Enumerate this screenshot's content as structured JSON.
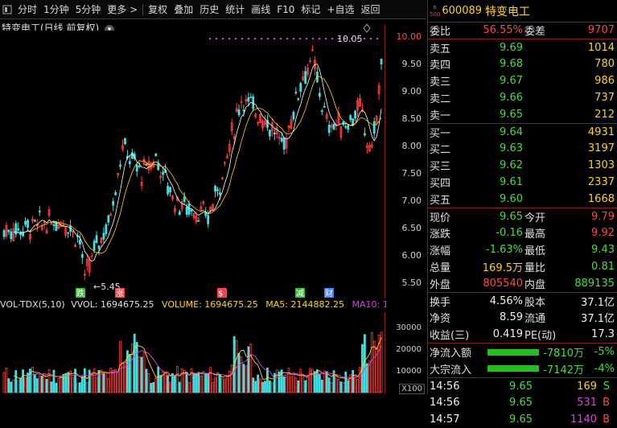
{
  "toolbar": {
    "items": [
      "分时",
      "1分钟",
      "5分钟",
      "更多 >",
      "复权",
      "叠加",
      "历史",
      "统计",
      "画线",
      "F10",
      "标记",
      "+自选",
      "返回"
    ]
  },
  "chart": {
    "title": "特变电工(日线 前复权)",
    "price_high_label": "10.05",
    "price_low_label": "5.45",
    "y_ticks": [
      "10.00",
      "9.50",
      "9.00",
      "8.50",
      "8.00",
      "7.50",
      "7.00",
      "6.50",
      "6.00",
      "5.50"
    ],
    "markers": [
      {
        "text": "跌",
        "color": "#30c030"
      },
      {
        "text": "涨",
        "color": "#ff4040"
      },
      {
        "text": "$",
        "color": "#ff4040"
      },
      {
        "text": "减",
        "color": "#30c030"
      },
      {
        "text": "财",
        "color": "#4080ff"
      }
    ]
  },
  "volume": {
    "name": "VOL-TDX(5,10)",
    "vvol": "VVOL: 1694675.25",
    "volume": "VOLUME: 1694675.25",
    "ma5": "MA5: 2144882.25",
    "ma10": "MA10: 1",
    "y_ticks": [
      "30000",
      "20000",
      "10000"
    ],
    "unit": "X100"
  },
  "quote": {
    "badge_top": "R",
    "badge_bot": "500",
    "code": "600089",
    "name": "特变电工",
    "weibi_label": "委比",
    "weibi": "56.55%",
    "weicha_label": "委差",
    "weicha": "9707",
    "asks": [
      {
        "label": "卖五",
        "price": "9.69",
        "vol": "1014"
      },
      {
        "label": "卖四",
        "price": "9.68",
        "vol": "780"
      },
      {
        "label": "卖三",
        "price": "9.67",
        "vol": "986"
      },
      {
        "label": "卖二",
        "price": "9.66",
        "vol": "737"
      },
      {
        "label": "卖一",
        "price": "9.65",
        "vol": "212"
      }
    ],
    "bids": [
      {
        "label": "买一",
        "price": "9.64",
        "vol": "4931"
      },
      {
        "label": "买二",
        "price": "9.63",
        "vol": "3197"
      },
      {
        "label": "买三",
        "price": "9.62",
        "vol": "1303"
      },
      {
        "label": "买四",
        "price": "9.61",
        "vol": "2337"
      },
      {
        "label": "买五",
        "price": "9.60",
        "vol": "1668"
      }
    ],
    "stats": [
      {
        "l1": "现价",
        "v1": "9.65",
        "c1": "g",
        "l2": "今开",
        "v2": "9.79",
        "c2": "r"
      },
      {
        "l1": "涨跌",
        "v1": "-0.16",
        "c1": "g",
        "l2": "最高",
        "v2": "9.92",
        "c2": "r"
      },
      {
        "l1": "涨幅",
        "v1": "-1.63%",
        "c1": "g",
        "l2": "最低",
        "v2": "9.43",
        "c2": "g"
      },
      {
        "l1": "总量",
        "v1": "169.5万",
        "c1": "y",
        "l2": "量比",
        "v2": "0.81",
        "c2": "g"
      },
      {
        "l1": "外盘",
        "v1": "805540",
        "c1": "r",
        "l2": "内盘",
        "v2": "889135",
        "c2": "g"
      }
    ],
    "stats2": [
      {
        "l1": "换手",
        "v1": "4.56%",
        "c1": "w",
        "l2": "股本",
        "v2": "37.1亿",
        "c2": "w"
      },
      {
        "l1": "净资",
        "v1": "8.59",
        "c1": "w",
        "l2": "流通",
        "v2": "37.1亿",
        "c2": "w"
      },
      {
        "l1": "收益(三)",
        "v1": "0.419",
        "c1": "w",
        "l2": "PE(动)",
        "v2": "17.3",
        "c2": "w"
      }
    ],
    "flows": [
      {
        "label": "净流入额",
        "value": "-7810万",
        "pct": "-5%"
      },
      {
        "label": "大宗流入",
        "value": "-7142万",
        "pct": "-4%"
      }
    ],
    "ticks": [
      {
        "time": "14:56",
        "price": "9.65",
        "vol": "169",
        "side": "S",
        "color": "y",
        "side_color": "g"
      },
      {
        "time": "14:56",
        "price": "9.65",
        "vol": "531",
        "side": "B",
        "color": "m",
        "side_color": "r"
      },
      {
        "time": "14:57",
        "price": "9.65",
        "vol": "1140",
        "side": "B",
        "color": "m",
        "side_color": "r"
      }
    ]
  },
  "colors": {
    "up": "#ff3c3c",
    "down": "#40e0e0",
    "ma5": "#ffffff",
    "ma10": "#ffd700",
    "ma20": "#e040e0",
    "accent_red": "#8b1a1a"
  }
}
